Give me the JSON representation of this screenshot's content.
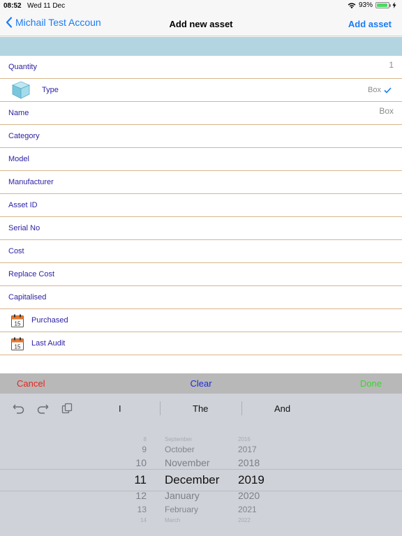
{
  "status": {
    "time": "08:52",
    "date": "Wed 11 Dec",
    "battery": "93%",
    "battery_level": 0.93
  },
  "nav": {
    "back_label": "Michail Test Accoun",
    "title": "Add new asset",
    "action_label": "Add asset"
  },
  "form": {
    "quantity": {
      "label": "Quantity",
      "value": "1"
    },
    "type": {
      "label": "Type",
      "value": "Box"
    },
    "name": {
      "label": "Name",
      "value": "Box"
    },
    "category": {
      "label": "Category"
    },
    "model": {
      "label": "Model"
    },
    "manufacturer": {
      "label": "Manufacturer"
    },
    "asset_id": {
      "label": "Asset ID"
    },
    "serial_no": {
      "label": "Serial No"
    },
    "cost": {
      "label": "Cost"
    },
    "replace_cost": {
      "label": "Replace Cost"
    },
    "capitalised": {
      "label": "Capitalised"
    },
    "purchased": {
      "label": "Purchased"
    },
    "last_audit": {
      "label": "Last Audit"
    }
  },
  "toolbar": {
    "cancel": "Cancel",
    "clear": "Clear",
    "done": "Done"
  },
  "keyboard": {
    "suggestions": [
      "I",
      "The",
      "And"
    ]
  },
  "picker": {
    "days": [
      "8",
      "9",
      "10",
      "11",
      "12",
      "13",
      "14"
    ],
    "months": [
      "September",
      "October",
      "November",
      "December",
      "January",
      "February",
      "March"
    ],
    "years": [
      "2016",
      "2017",
      "2018",
      "2019",
      "2020",
      "2021",
      "2022"
    ],
    "selected": {
      "day": "11",
      "month": "December",
      "year": "2019"
    }
  },
  "colors": {
    "accent": "#1a7cf4",
    "label": "#2a1fa3",
    "divider": "#d8b58a",
    "band": "#b3d5e1",
    "cancel": "#e8231e",
    "clear": "#1c2bd8",
    "done": "#39d62c"
  }
}
